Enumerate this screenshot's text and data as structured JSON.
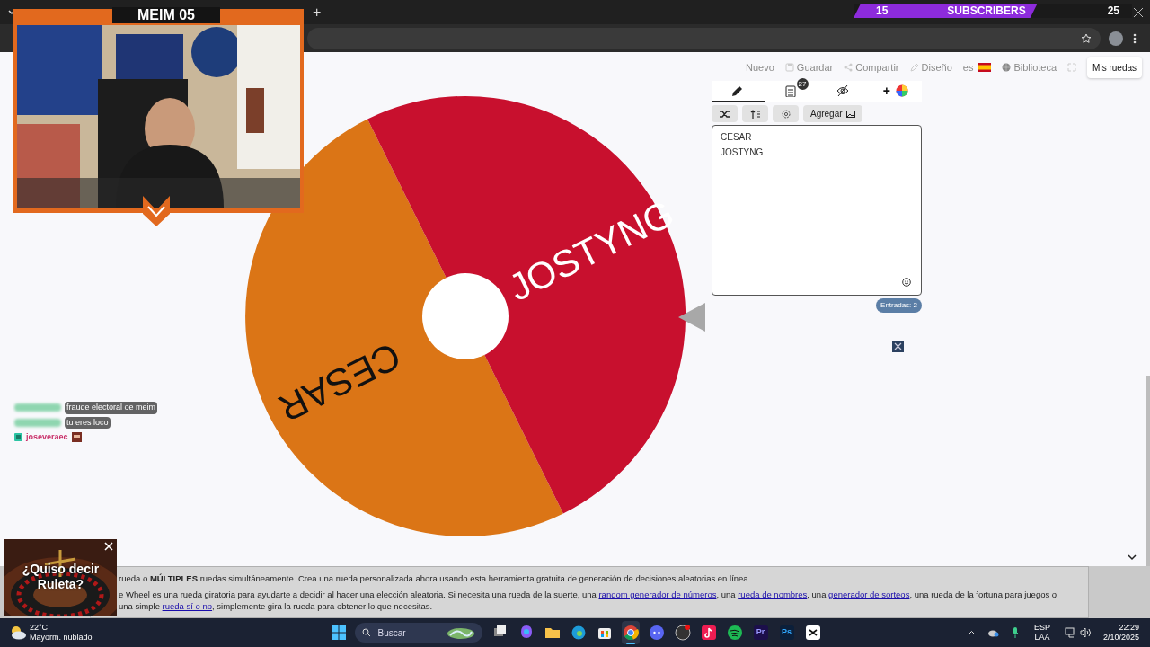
{
  "browser": {
    "new_tab": "+"
  },
  "stream_overlay": {
    "title": "MEIM 05",
    "subscribers": {
      "current": "15",
      "label": "SUBSCRIBERS",
      "goal": "25",
      "level": 0.66
    }
  },
  "toolbar": {
    "items": [
      {
        "label": "Nuevo",
        "kind": "new"
      },
      {
        "label": "Guardar",
        "kind": "save"
      },
      {
        "label": "Compartir",
        "kind": "share"
      },
      {
        "label": "Diseño",
        "kind": "design"
      },
      {
        "label": "es",
        "kind": "language"
      },
      {
        "label": "Biblioteca",
        "kind": "library"
      }
    ],
    "my_wheels": "Mis ruedas"
  },
  "wheel": {
    "entries": [
      {
        "label": "CESAR",
        "color": "#db7516"
      },
      {
        "label": "JOSTYNG",
        "color": "#c8102e"
      }
    ]
  },
  "editor": {
    "tabs": [
      {
        "kind": "edit",
        "selected": true
      },
      {
        "kind": "results",
        "badge": "27",
        "selected": false
      },
      {
        "kind": "hide",
        "selected": false
      },
      {
        "kind": "appearance",
        "label": "+",
        "selected": false
      }
    ],
    "add_button": "Agregar",
    "lines": [
      "CESAR",
      "JOSTYNG"
    ],
    "count": "Entradas: 2"
  },
  "chat": [
    {
      "user_hidden": true,
      "text": "fraude electoral oe meim"
    },
    {
      "user_hidden": true,
      "text": "tu eres loco"
    },
    {
      "user_hidden": false,
      "user": "joseveraec"
    }
  ],
  "ad": {
    "text": "¿Quiso decir Ruleta?"
  },
  "info": {
    "paragraphs": [
      [
        {
          "text": "rueda o **MÚLTIPLES** ruedas simultáneamente. Crea una rueda personalizada ahora usando esta herramienta gratuita de generación de decisiones aleatorias en línea.",
          "link": false
        }
      ],
      [
        {
          "text": "e Wheel es una rueda giratoria para ayudarte a decidir al hacer una elección aleatoria. Si necesita una rueda de la suerte, una ",
          "link": false
        },
        {
          "text": "random generador de números",
          "link": true
        },
        {
          "text": ", una ",
          "link": false
        },
        {
          "text": "rueda de nombres",
          "link": true
        },
        {
          "text": ", una ",
          "link": false
        },
        {
          "text": "generador de sorteos",
          "link": true
        },
        {
          "text": ", una rueda de la fortuna para juegos o una simple ",
          "link": false
        },
        {
          "text": "rueda sí o no",
          "link": true
        },
        {
          "text": ", simplemente gira la rueda para obtener lo que necesitas.",
          "link": false
        }
      ]
    ]
  },
  "taskbar": {
    "weather": {
      "temp": "22°C",
      "desc": "Mayorm. nublado"
    },
    "search": "Buscar",
    "apps": [
      {
        "kind": "taskview",
        "selected": false
      },
      {
        "kind": "copilot",
        "selected": false
      },
      {
        "kind": "folder",
        "selected": false
      },
      {
        "kind": "edge",
        "selected": false
      },
      {
        "kind": "store",
        "selected": false
      },
      {
        "kind": "chrome",
        "selected": true
      },
      {
        "kind": "discord",
        "selected": false
      },
      {
        "kind": "obs",
        "selected": false
      },
      {
        "kind": "tiktok",
        "selected": false
      },
      {
        "kind": "spotify",
        "selected": false
      },
      {
        "kind": "premiere",
        "label": "Pr",
        "selected": false
      },
      {
        "kind": "photoshop",
        "label": "Ps",
        "selected": false
      },
      {
        "kind": "capcut",
        "selected": false
      }
    ],
    "lang": "ESP",
    "layout": "LAA",
    "time": "22:29",
    "date": "2/10/2025"
  }
}
